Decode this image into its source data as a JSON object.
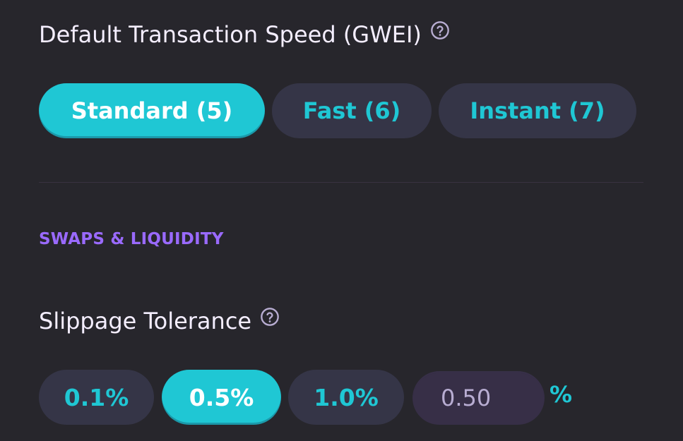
{
  "transaction_speed": {
    "title": "Default Transaction Speed (GWEI)",
    "help_icon": "question-circle-icon",
    "options": [
      {
        "label": "Standard (5)",
        "selected": true
      },
      {
        "label": "Fast (6)",
        "selected": false
      },
      {
        "label": "Instant (7)",
        "selected": false
      }
    ]
  },
  "swaps": {
    "section_label": "SWAPS & LIQUIDITY",
    "slippage": {
      "title": "Slippage Tolerance",
      "help_icon": "question-circle-icon",
      "options": [
        {
          "label": "0.1%",
          "selected": false
        },
        {
          "label": "0.5%",
          "selected": true
        },
        {
          "label": "1.0%",
          "selected": false
        }
      ],
      "custom_value": "0.50",
      "unit": "%"
    }
  },
  "colors": {
    "background": "#27262c",
    "primary": "#1fc7d4",
    "tertiary": "#353547",
    "secondary_text": "#9a6aff",
    "text": "#f4eeff",
    "input_bg": "#372f47"
  }
}
